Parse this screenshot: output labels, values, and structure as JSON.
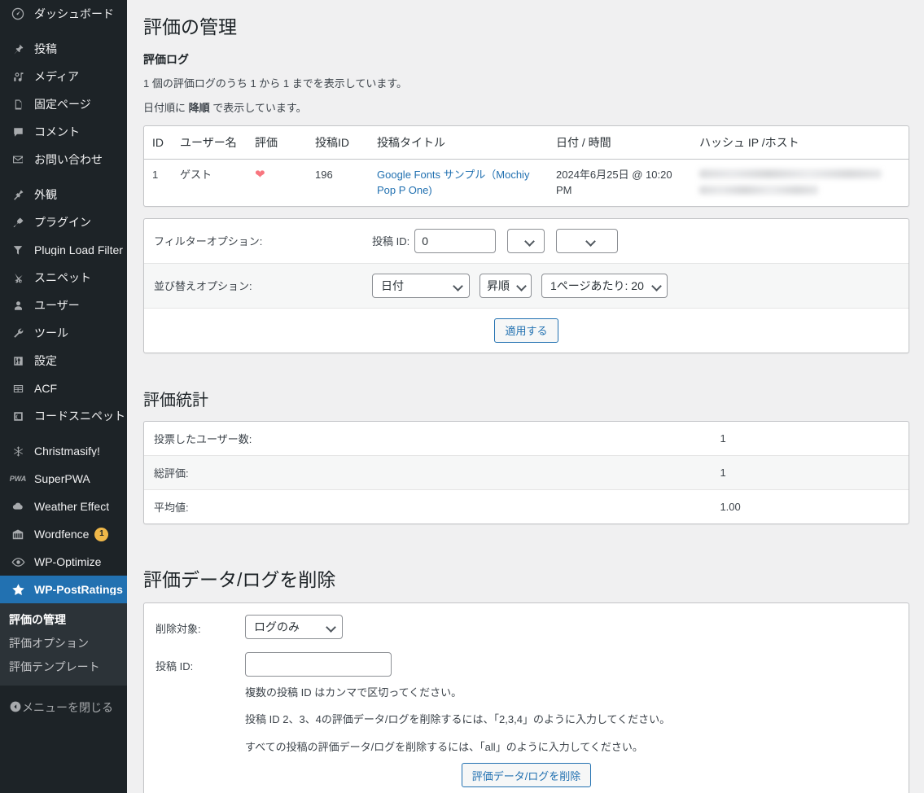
{
  "sidebar": {
    "items": [
      {
        "label": "ダッシュボード",
        "icon": "dashboard-icon",
        "sep_after": true
      },
      {
        "label": "投稿",
        "icon": "pin-icon"
      },
      {
        "label": "メディア",
        "icon": "media-icon"
      },
      {
        "label": "固定ページ",
        "icon": "page-icon"
      },
      {
        "label": "コメント",
        "icon": "comment-icon"
      },
      {
        "label": "お問い合わせ",
        "icon": "mail-icon",
        "sep_after": true
      },
      {
        "label": "外観",
        "icon": "appearance-icon"
      },
      {
        "label": "プラグイン",
        "icon": "plugin-icon"
      },
      {
        "label": "Plugin Load Filter",
        "icon": "filter-icon"
      },
      {
        "label": "スニペット",
        "icon": "scissors-icon"
      },
      {
        "label": "ユーザー",
        "icon": "user-icon"
      },
      {
        "label": "ツール",
        "icon": "wrench-icon"
      },
      {
        "label": "設定",
        "icon": "settings-icon"
      },
      {
        "label": "ACF",
        "icon": "acf-icon"
      },
      {
        "label": "コードスニペット",
        "icon": "code-icon",
        "sep_after": true
      },
      {
        "label": "Christmasify!",
        "icon": "snowflake-icon"
      },
      {
        "label": "SuperPWA",
        "icon": "pwa-icon"
      },
      {
        "label": "Weather Effect",
        "icon": "cloud-icon"
      },
      {
        "label": "Wordfence",
        "icon": "wordfence-icon",
        "badge": "1"
      },
      {
        "label": "WP-Optimize",
        "icon": "eye-icon"
      },
      {
        "label": "WP-PostRatings",
        "icon": "star-icon",
        "current": true
      }
    ],
    "submenu": [
      {
        "label": "評価の管理",
        "current": true
      },
      {
        "label": "評価オプション",
        "current": false
      },
      {
        "label": "評価テンプレート",
        "current": false
      }
    ],
    "collapse_label": "メニューを閉じる"
  },
  "page": {
    "title": "評価の管理",
    "log_heading": "評価ログ",
    "log_info_1": "1 個の評価ログのうち 1 から 1 までを表示しています。",
    "log_info_2_prefix": "日付順に ",
    "log_info_2_strong": "降順",
    "log_info_2_suffix": " で表示しています。"
  },
  "log_table": {
    "headers": [
      "ID",
      "ユーザー名",
      "評価",
      "投稿ID",
      "投稿タイトル",
      "日付 / 時間",
      "ハッシュ IP /ホスト"
    ],
    "rows": [
      {
        "id": "1",
        "username": "ゲスト",
        "rating_icon": "heart-icon",
        "rating_glyph": "❤",
        "post_id": "196",
        "post_title": "Google Fonts サンプル（Mochiy Pop P One)",
        "datetime": "2024年6月25日 @ 10:20 PM",
        "hash_ip_host": ""
      }
    ]
  },
  "filter": {
    "filter_label": "フィルターオプション:",
    "post_id_label": "投稿 ID:",
    "post_id_value": "0",
    "select_a_value": "",
    "select_b_value": "",
    "sort_label": "並び替えオプション:",
    "sort_by_value": "日付",
    "sort_order_value": "昇順",
    "per_page_value": "1ページあたり: 20",
    "apply_button": "適用する"
  },
  "stats": {
    "heading": "評価統計",
    "rows": [
      {
        "label": "投票したユーザー数:",
        "value": "1"
      },
      {
        "label": "総評価:",
        "value": "1"
      },
      {
        "label": "平均値:",
        "value": "1.00"
      }
    ]
  },
  "delete": {
    "heading": "評価データ/ログを削除",
    "target_label": "削除対象:",
    "target_value": "ログのみ",
    "post_id_label": "投稿 ID:",
    "post_id_value": "",
    "note_1": "複数の投稿 ID はカンマで区切ってください。",
    "note_2": "投稿 ID 2、3、4の評価データ/ログを削除するには、「2,3,4」のように入力してください。",
    "note_3": "すべての投稿の評価データ/ログを削除するには、「all」のように入力してください。",
    "button": "評価データ/ログを削除"
  },
  "colors": {
    "sidebar_bg": "#1d2327",
    "submenu_bg": "#2c3338",
    "accent": "#2271b1",
    "badge": "#f0b849",
    "page_bg": "#f0f0f1",
    "link": "#2271b1",
    "heart": "#f8767f"
  }
}
